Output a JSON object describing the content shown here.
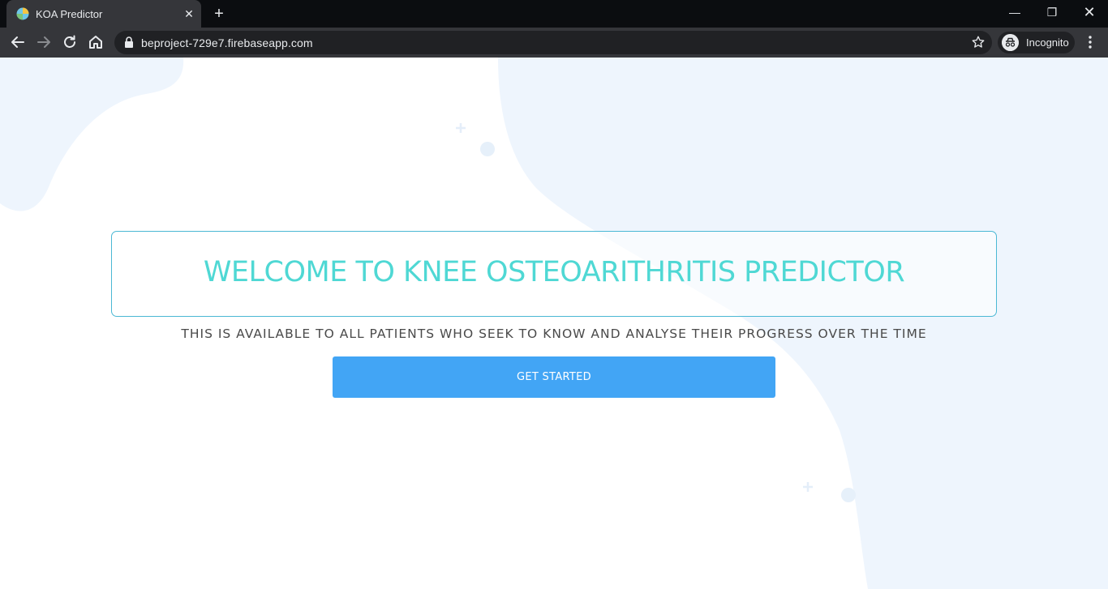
{
  "browser": {
    "tab_title": "KOA Predictor",
    "tab_close": "✕",
    "new_tab": "+",
    "url": "beproject-729e7.firebaseapp.com",
    "incognito_label": "Incognito",
    "window_controls": {
      "minimize": "—",
      "restore": "❐",
      "close": "✕"
    }
  },
  "page": {
    "welcome_title": "WELCOME TO KNEE OSTEOARITHRITIS PREDICTOR",
    "subtitle": "THIS IS AVAILABLE TO ALL PATIENTS WHO SEEK TO KNOW AND ANALYSE THEIR PROGRESS OVER THE TIME",
    "cta_label": "GET STARTED"
  },
  "colors": {
    "title_accent": "#4fd8d4",
    "card_border": "#4bb8d4",
    "button_bg": "#42a5f5",
    "blob_bg": "#eef5fd"
  }
}
